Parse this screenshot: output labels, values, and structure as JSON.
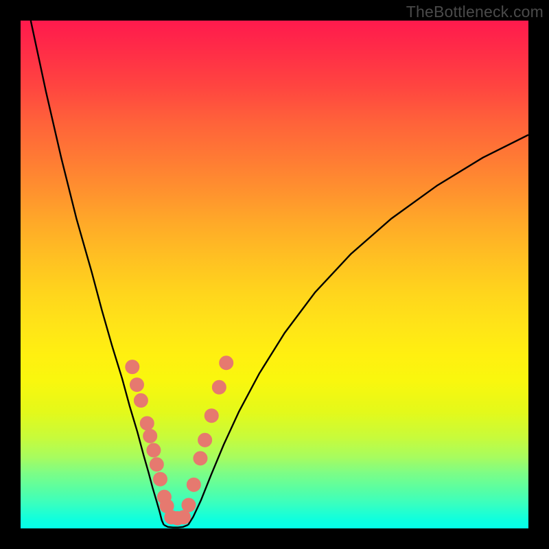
{
  "attribution": "TheBottleneck.com",
  "chart_data": {
    "type": "line",
    "title": "",
    "xlabel": "",
    "ylabel": "",
    "xlim": [
      0,
      100
    ],
    "ylim": [
      0,
      100
    ],
    "grid": false,
    "annotations": [],
    "series": [
      {
        "name": "left-branch",
        "x": [
          2,
          5,
          8,
          11,
          14,
          16,
          18,
          20,
          21.5,
          23,
          24.2,
          25.2,
          26,
          26.8,
          27.4,
          27.8,
          28.2
        ],
        "y": [
          100,
          86,
          73,
          61,
          50.5,
          43,
          36,
          29.5,
          24,
          19,
          14.5,
          11,
          8,
          5.3,
          3.2,
          1.6,
          0.7
        ]
      },
      {
        "name": "valley",
        "x": [
          28.2,
          29,
          30,
          31,
          32,
          33
        ],
        "y": [
          0.7,
          0.3,
          0.2,
          0.2,
          0.3,
          0.7
        ]
      },
      {
        "name": "right-branch",
        "x": [
          33,
          34,
          35.5,
          37.5,
          40,
          43,
          47,
          52,
          58,
          65,
          73,
          82,
          91,
          100
        ],
        "y": [
          0.7,
          2.3,
          5.5,
          10.5,
          16.5,
          23,
          30.5,
          38.5,
          46.5,
          54,
          61,
          67.5,
          73,
          77.5
        ]
      }
    ],
    "beads_left": [
      {
        "x": 22.0,
        "y": 31.8
      },
      {
        "x": 22.9,
        "y": 28.3
      },
      {
        "x": 23.7,
        "y": 25.2
      },
      {
        "x": 24.9,
        "y": 20.7
      },
      {
        "x": 25.5,
        "y": 18.2
      },
      {
        "x": 26.2,
        "y": 15.4
      },
      {
        "x": 26.8,
        "y": 12.6
      },
      {
        "x": 27.5,
        "y": 9.7
      },
      {
        "x": 28.3,
        "y": 6.2
      },
      {
        "x": 28.8,
        "y": 4.4
      }
    ],
    "beads_right": [
      {
        "x": 33.1,
        "y": 4.6
      },
      {
        "x": 34.1,
        "y": 8.6
      },
      {
        "x": 35.4,
        "y": 13.8
      },
      {
        "x": 36.3,
        "y": 17.4
      },
      {
        "x": 37.6,
        "y": 22.2
      },
      {
        "x": 39.1,
        "y": 27.8
      },
      {
        "x": 40.5,
        "y": 32.6
      }
    ],
    "beads_bottom": [
      {
        "x": 29.7,
        "y": 2.2
      },
      {
        "x": 30.9,
        "y": 2.0
      },
      {
        "x": 32.1,
        "y": 2.2
      }
    ],
    "bead_radius": 10
  }
}
